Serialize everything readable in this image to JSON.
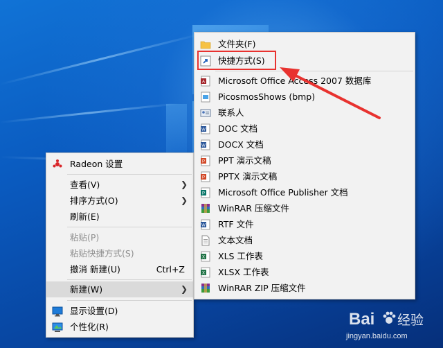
{
  "desktop_menu": {
    "items": [
      {
        "label": "Radeon 设置",
        "icon": "radeon-icon"
      },
      {
        "label": "查看(V)",
        "submenu": true
      },
      {
        "label": "排序方式(O)",
        "submenu": true
      },
      {
        "label": "刷新(E)"
      },
      {
        "label": "粘贴(P)",
        "disabled": true
      },
      {
        "label": "粘贴快捷方式(S)",
        "disabled": true
      },
      {
        "label": "撤消 新建(U)",
        "shortcut": "Ctrl+Z"
      },
      {
        "label": "新建(W)",
        "submenu": true,
        "highlighted": true
      },
      {
        "label": "显示设置(D)",
        "icon": "display-settings-icon"
      },
      {
        "label": "个性化(R)",
        "icon": "personalize-icon"
      }
    ]
  },
  "new_submenu": {
    "items": [
      {
        "label": "文件夹(F)",
        "icon": "folder-icon"
      },
      {
        "label": "快捷方式(S)",
        "icon": "shortcut-icon"
      },
      {
        "label": "Microsoft Office Access 2007 数据库",
        "icon": "access-icon"
      },
      {
        "label": "PicosmosShows (bmp)",
        "icon": "bmp-icon"
      },
      {
        "label": "联系人",
        "icon": "contact-icon"
      },
      {
        "label": "DOC 文档",
        "icon": "doc-icon"
      },
      {
        "label": "DOCX 文档",
        "icon": "docx-icon"
      },
      {
        "label": "PPT 演示文稿",
        "icon": "ppt-icon"
      },
      {
        "label": "PPTX 演示文稿",
        "icon": "pptx-icon"
      },
      {
        "label": "Microsoft Office Publisher 文档",
        "icon": "publisher-icon"
      },
      {
        "label": "WinRAR 压缩文件",
        "icon": "winrar-icon"
      },
      {
        "label": "RTF 文件",
        "icon": "rtf-icon"
      },
      {
        "label": "文本文档",
        "icon": "txt-icon"
      },
      {
        "label": "XLS 工作表",
        "icon": "xls-icon"
      },
      {
        "label": "XLSX 工作表",
        "icon": "xlsx-icon"
      },
      {
        "label": "WinRAR ZIP 压缩文件",
        "icon": "winrar-zip-icon"
      }
    ]
  },
  "annotation": {
    "color": "#e8322f"
  },
  "watermark": {
    "brand": "Bai",
    "brand2": "经验",
    "url": "jingyan.baidu.com"
  }
}
